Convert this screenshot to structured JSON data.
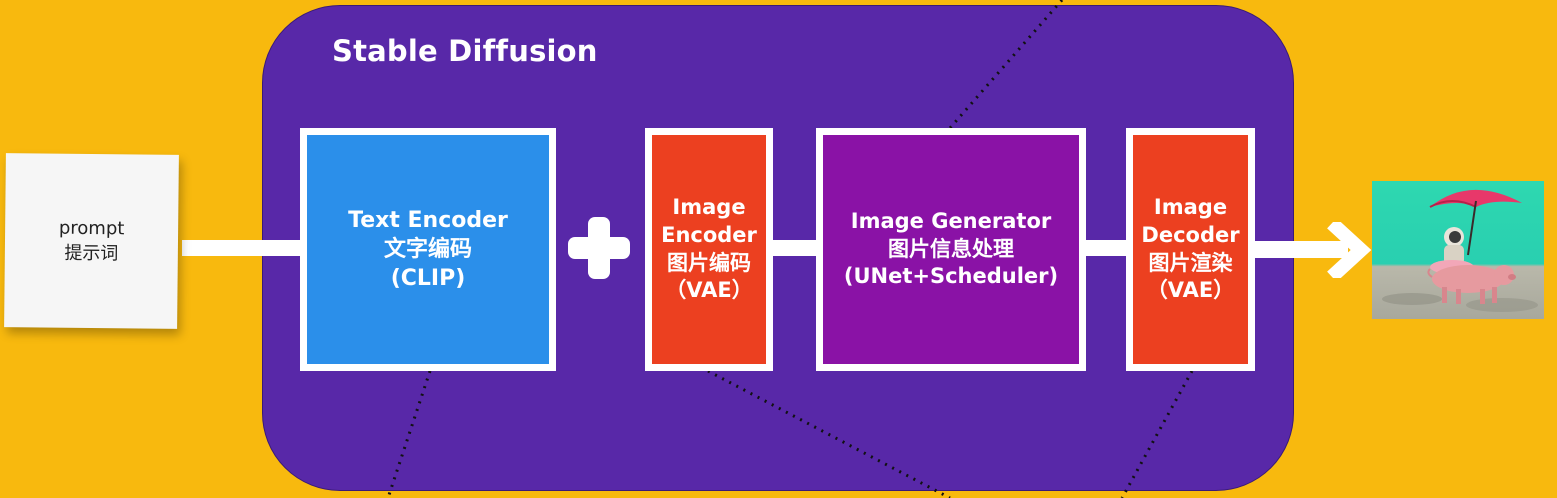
{
  "title": "Stable Diffusion",
  "prompt": {
    "line1": "prompt",
    "line2": "提示词"
  },
  "text_encoder": {
    "line1": "Text Encoder",
    "line2": "文字编码",
    "line3": "(CLIP)"
  },
  "image_encoder": {
    "line1": "Image",
    "line2": "Encoder",
    "line3": "图片编码",
    "line4": "（VAE）"
  },
  "image_generator": {
    "line1": "Image Generator",
    "line2": "图片信息处理",
    "line3": "(UNet+Scheduler)"
  },
  "image_decoder": {
    "line1": "Image",
    "line2": "Decoder",
    "line3": "图片渲染",
    "line4": "（VAE）"
  },
  "colors": {
    "background": "#F8B90E",
    "panel": "#5828A8",
    "text_encoder": "#2B8FEA",
    "vae": "#EC4020",
    "generator": "#8A12A6"
  }
}
